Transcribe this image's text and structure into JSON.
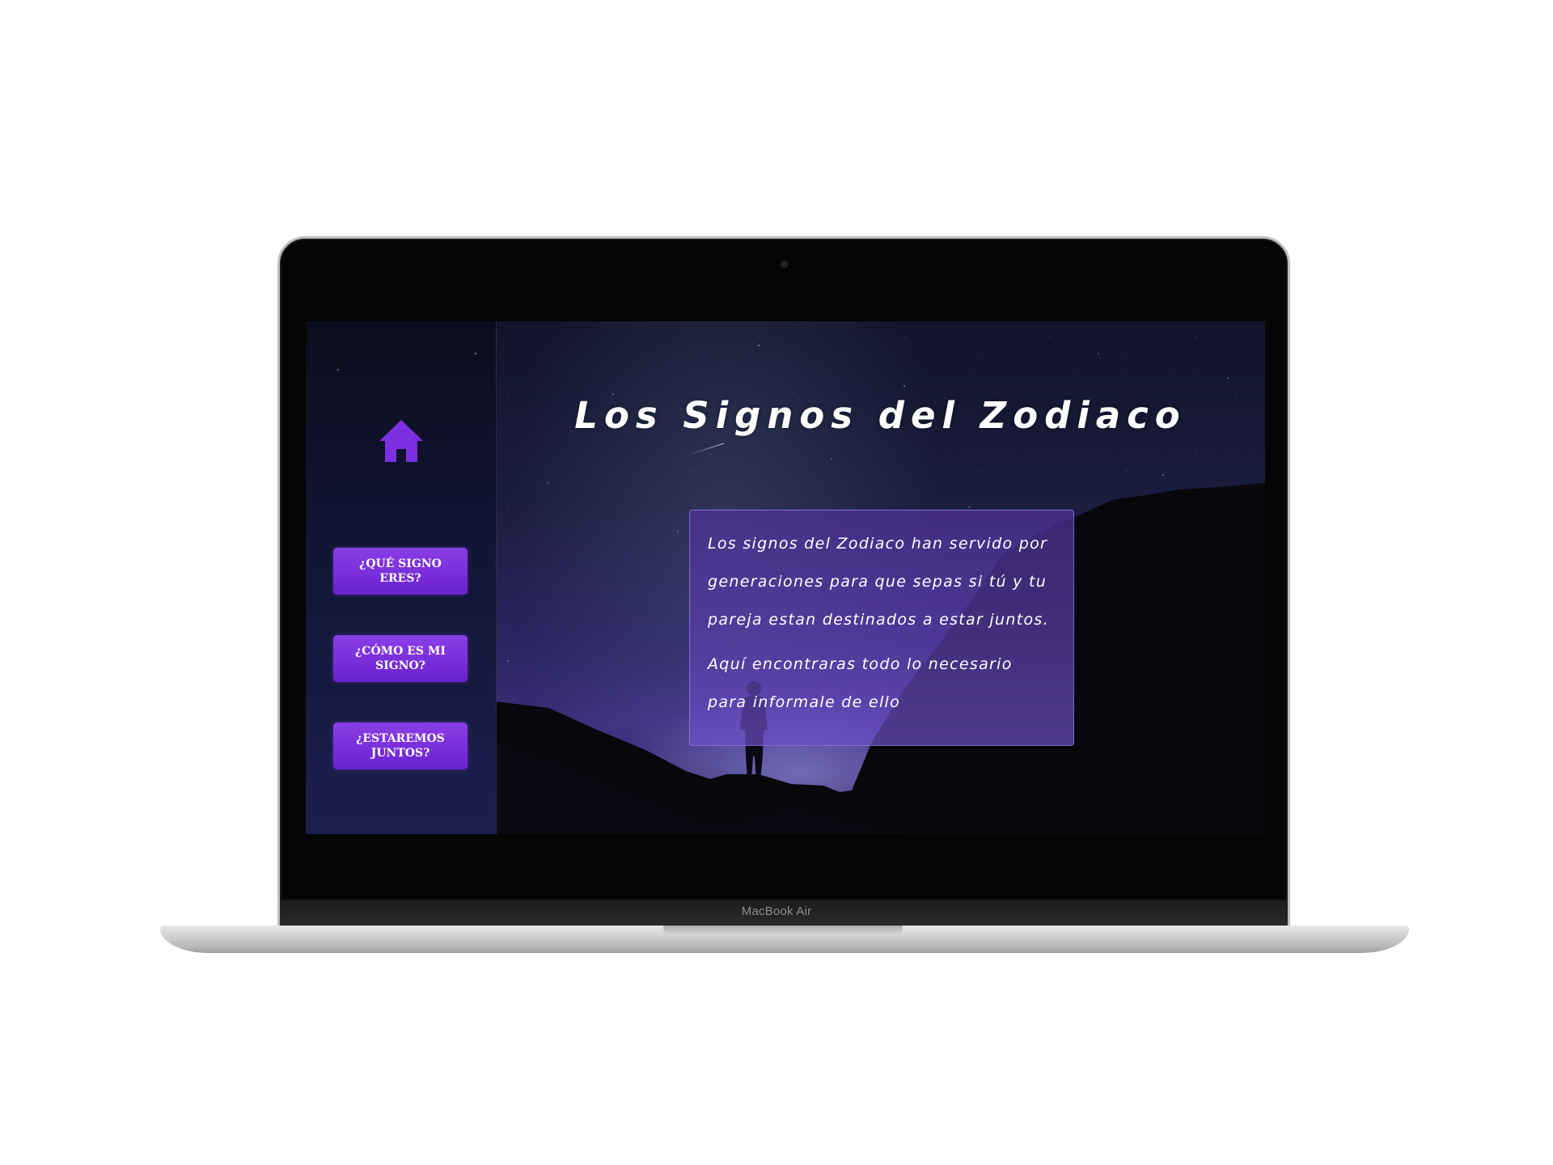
{
  "device": {
    "label": "MacBook Air"
  },
  "sidebar": {
    "home_icon": "home-icon",
    "items": [
      {
        "label": "¿QUÉ SIGNO ERES?"
      },
      {
        "label": "¿CÓMO ES MI SIGNO?"
      },
      {
        "label": "¿ESTAREMOS JUNTOS?"
      }
    ]
  },
  "main": {
    "title": "Los Signos del Zodiaco",
    "paragraphs": [
      "Los signos del Zodiaco han servido por generaciones para que sepas si tú y tu pareja estan destinados a estar juntos.",
      "Aquí encontraras todo lo necesario para informale de ello"
    ]
  },
  "colors": {
    "accent": "#7b2fe0",
    "button_gradient_top": "#8a3ee6",
    "button_gradient_bottom": "#6a22cf",
    "card_tint": "#5a3aa8"
  }
}
